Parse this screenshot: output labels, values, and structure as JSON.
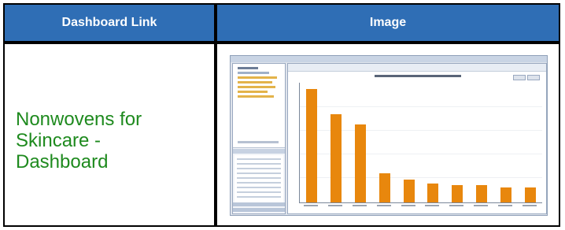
{
  "table": {
    "headers": [
      "Dashboard Link",
      "Image"
    ],
    "rows": [
      {
        "link_text": "Nonwovens for\nSkincare -\nDashboard",
        "image": "dashboard-screenshot-thumbnail"
      }
    ]
  },
  "colors": {
    "header_bg": "#2f6eb5",
    "header_text": "#ffffff",
    "link": "#1e8a1e",
    "bar": "#e8870d"
  },
  "thumbnail_chart": {
    "type": "bar",
    "values": [
      100,
      78,
      69,
      26,
      20,
      17,
      15,
      15,
      13,
      13
    ]
  }
}
